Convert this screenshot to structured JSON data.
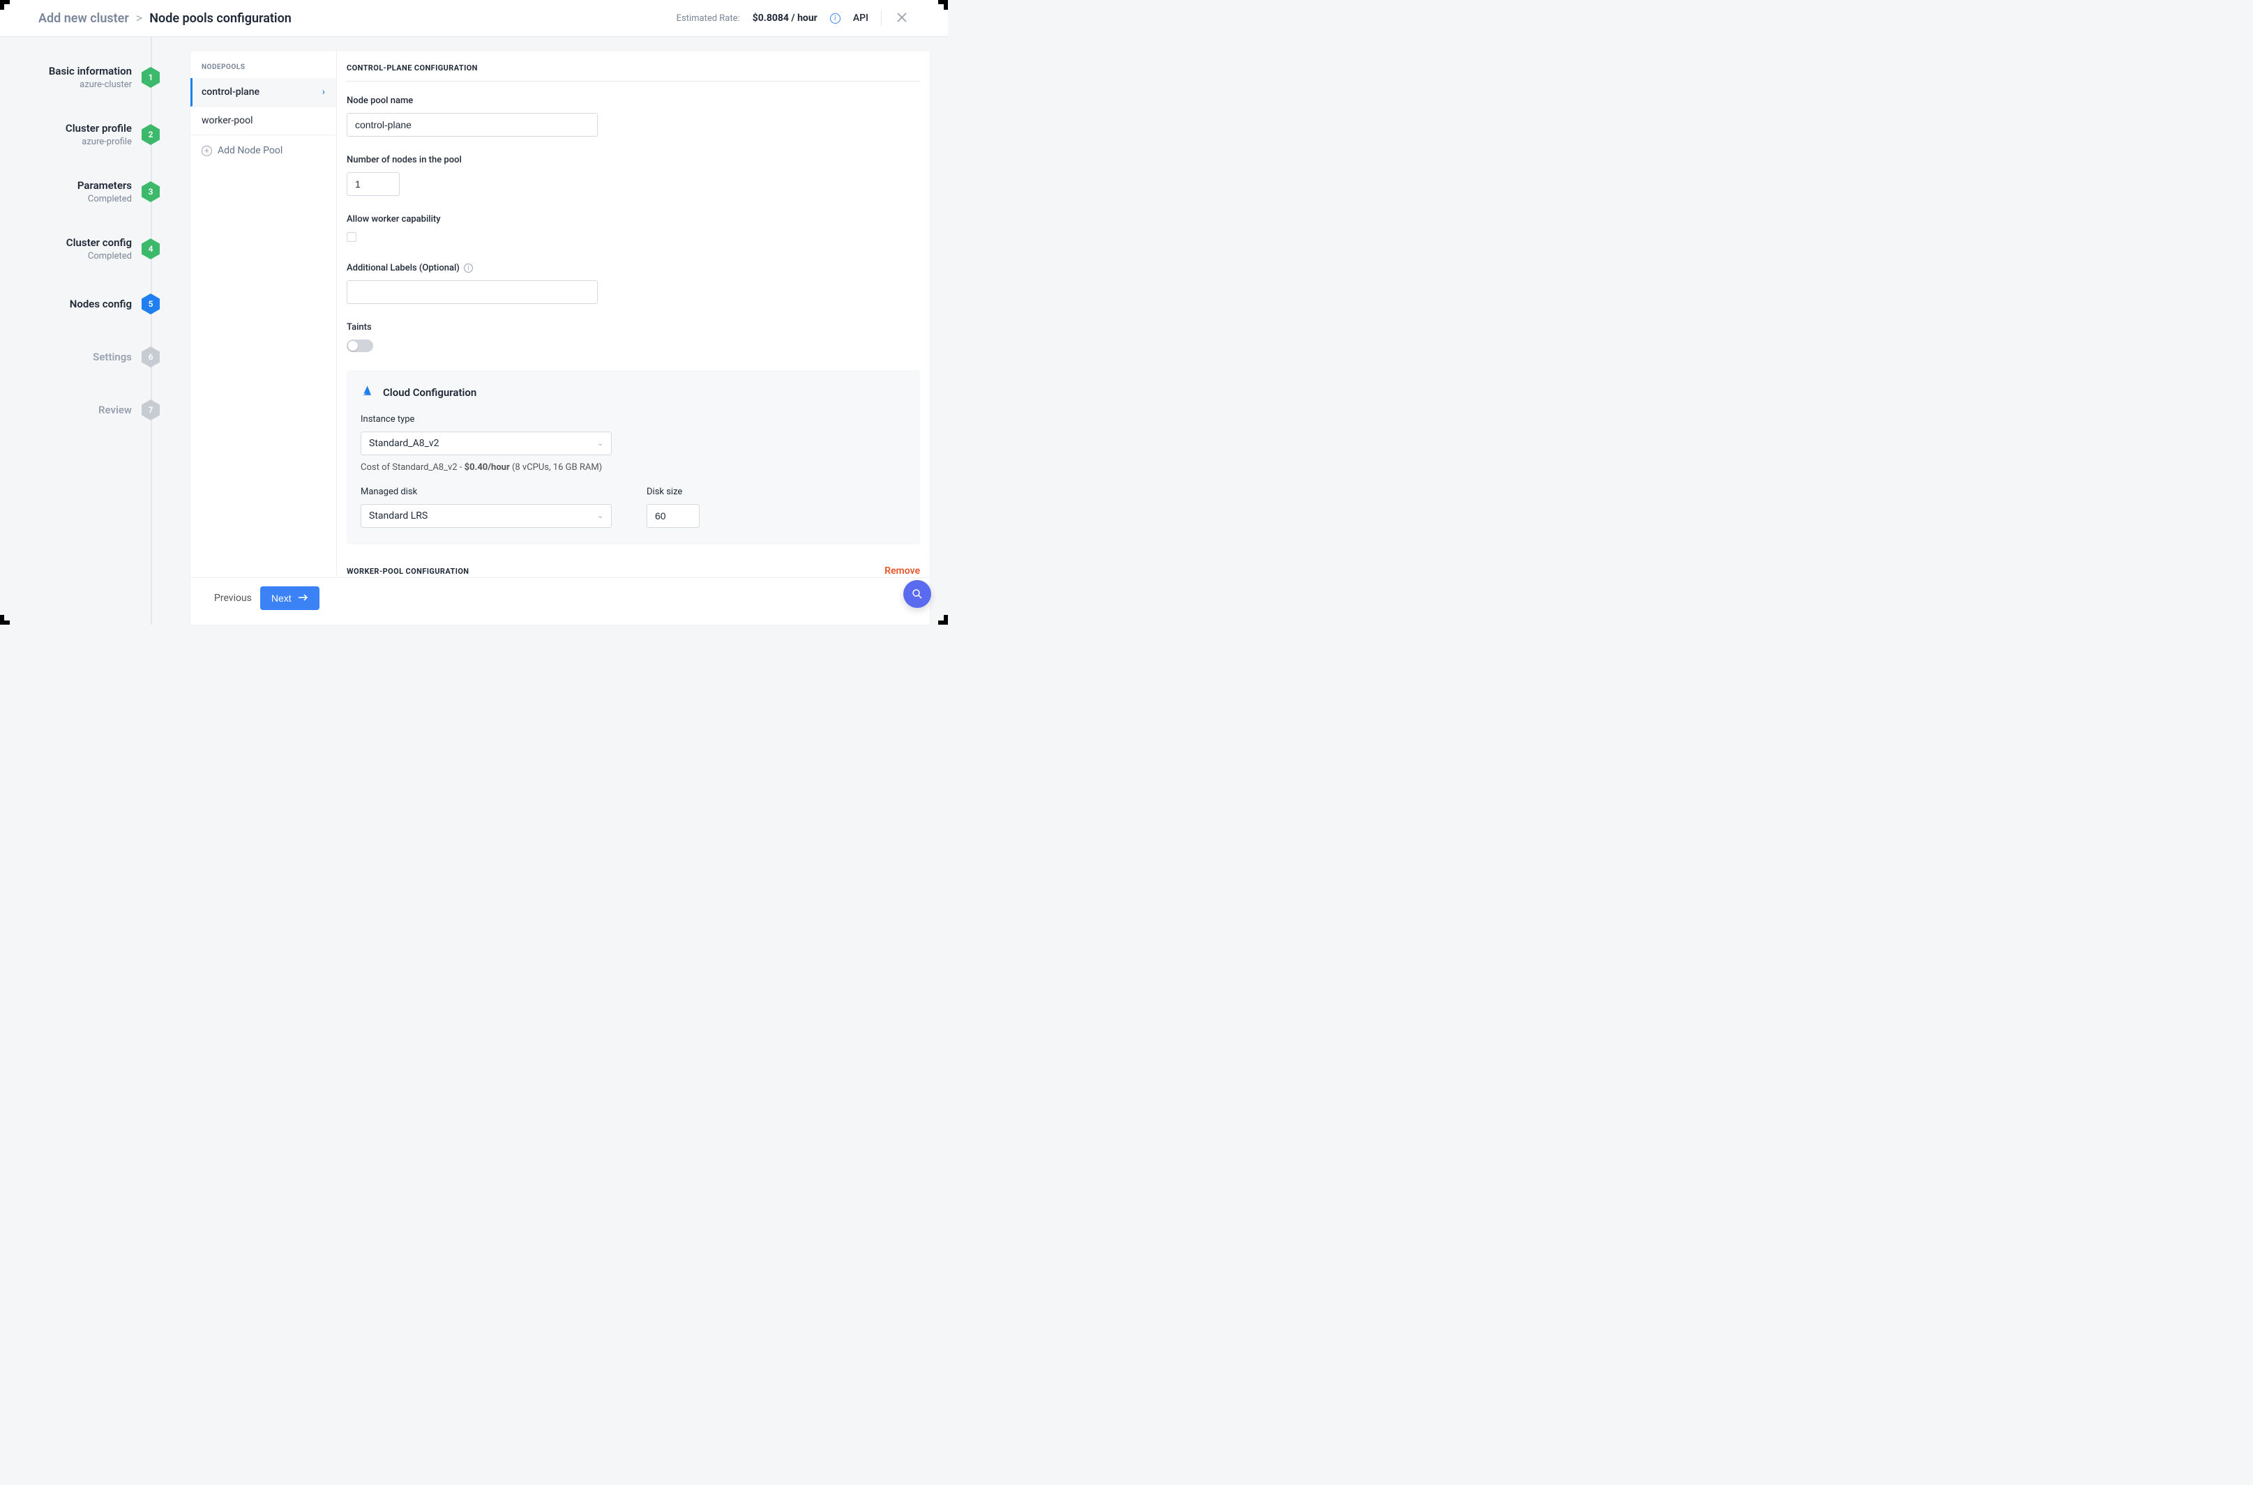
{
  "header": {
    "breadcrumb_root": "Add new cluster",
    "breadcrumb_current": "Node pools configuration",
    "rate_label": "Estimated Rate:",
    "rate_value": "$0.8084 / hour",
    "api_link": "API"
  },
  "steps": [
    {
      "title": "Basic information",
      "subtitle": "azure-cluster",
      "num": "1",
      "state": "done"
    },
    {
      "title": "Cluster profile",
      "subtitle": "azure-profile",
      "num": "2",
      "state": "done"
    },
    {
      "title": "Parameters",
      "subtitle": "Completed",
      "num": "3",
      "state": "done"
    },
    {
      "title": "Cluster config",
      "subtitle": "Completed",
      "num": "4",
      "state": "done"
    },
    {
      "title": "Nodes config",
      "subtitle": "",
      "num": "5",
      "state": "active"
    },
    {
      "title": "Settings",
      "subtitle": "",
      "num": "6",
      "state": "pending"
    },
    {
      "title": "Review",
      "subtitle": "",
      "num": "7",
      "state": "pending"
    }
  ],
  "nodepools": {
    "header": "NODEPOOLS",
    "items": [
      {
        "label": "control-plane",
        "active": true
      },
      {
        "label": "worker-pool",
        "active": false
      }
    ],
    "add_label": "Add Node Pool"
  },
  "form": {
    "section_title": "CONTROL-PLANE CONFIGURATION",
    "node_pool_name_label": "Node pool name",
    "node_pool_name_value": "control-plane",
    "node_count_label": "Number of nodes in the pool",
    "node_count_value": "1",
    "allow_worker_label": "Allow worker capability",
    "additional_labels_label": "Additional Labels (Optional)",
    "taints_label": "Taints",
    "cloud": {
      "title": "Cloud Configuration",
      "instance_type_label": "Instance type",
      "instance_type_value": "Standard_A8_v2",
      "cost_prefix": "Cost of Standard_A8_v2 - ",
      "cost_bold": "$0.40/hour",
      "cost_suffix": " (8 vCPUs, 16 GB RAM)",
      "managed_disk_label": "Managed disk",
      "managed_disk_value": "Standard LRS",
      "disk_size_label": "Disk size",
      "disk_size_value": "60"
    },
    "worker_section_title": "WORKER-POOL CONFIGURATION",
    "remove_label": "Remove"
  },
  "footer": {
    "previous": "Previous",
    "next": "Next"
  }
}
